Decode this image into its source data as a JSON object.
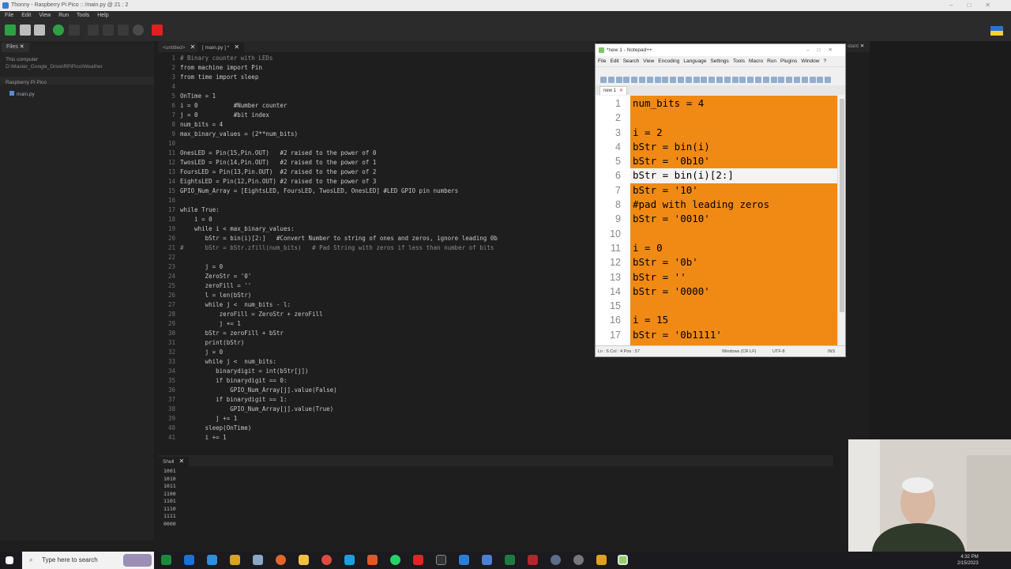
{
  "thonny": {
    "title": "Thonny - Raspberry Pi Pico :: /main.py @ 21 : 2",
    "menu": [
      "File",
      "Edit",
      "View",
      "Run",
      "Tools",
      "Help"
    ],
    "files_tab": "Files",
    "this_computer": "This computer",
    "computer_path": "D:\\Master_Google_Drive\\RPiPico\\Weather",
    "pico_label": "Raspberry Pi Pico",
    "pico_file": "main.py",
    "tabs": [
      "<untitled>",
      "[ main.py ] *"
    ],
    "shell_tab": "Shell",
    "right_tab_partial": "stant",
    "code_lines": [
      "# Binary counter with LEDs",
      "from machine import Pin",
      "from time import sleep",
      "",
      "OnTime = 1",
      "i = 0          #Number counter",
      "j = 0          #bit index",
      "num_bits = 4",
      "max_binary_values = (2**num_bits)",
      "",
      "OnesLED = Pin(15,Pin.OUT)   #2 raised to the power of 0",
      "TwosLED = Pin(14,Pin.OUT)   #2 raised to the power of 1",
      "FoursLED = Pin(13,Pin.OUT)  #2 raised to the power of 2",
      "EightsLED = Pin(12,Pin.OUT) #2 raised to the power of 3",
      "GPIO_Num_Array = [EightsLED, FoursLED, TwosLED, OnesLED] #LED GPIO pin numbers",
      "",
      "while True:",
      "    i = 0",
      "    while i < max_binary_values:",
      "       bStr = bin(i)[2:]   #Convert Number to string of ones and zeros, ignore leading 0b",
      "#      bStr = bStr.zfill(num_bits)   # Pad String with zeros if less than number of bits",
      "",
      "       j = 0",
      "       ZeroStr = '0'",
      "       zeroFill = ''",
      "       l = len(bStr)",
      "       while j <  num_bits - l:",
      "           zeroFill = ZeroStr + zeroFill",
      "           j += 1",
      "       bStr = zeroFill + bStr",
      "       print(bStr)",
      "       j = 0",
      "       while j <  num_bits:",
      "          binarydigit = int(bStr[j])",
      "          if binarydigit == 0:",
      "              GPIO_Num_Array[j].value(False)",
      "          if binarydigit == 1:",
      "              GPIO_Num_Array[j].value(True)",
      "          j += 1",
      "       sleep(OnTime)",
      "       i += 1"
    ],
    "shell_lines": [
      "1001",
      "1010",
      "1011",
      "1100",
      "1101",
      "1110",
      "1111",
      "0000"
    ]
  },
  "notepad": {
    "title": "*new 1 - Notepad++",
    "menu": [
      "File",
      "Edit",
      "Search",
      "View",
      "Encoding",
      "Language",
      "Settings",
      "Tools",
      "Macro",
      "Run",
      "Plugins",
      "Window",
      "?"
    ],
    "tab": "new 1",
    "lines": [
      "num_bits = 4",
      "",
      "i = 2",
      "bStr = bin(i)",
      "bStr = '0b10'",
      "bStr = bin(i)[2:]",
      "bStr = '10'",
      "#pad with leading zeros",
      "bStr = '0010'",
      "",
      "i = 0",
      "bStr = '0b'",
      "bStr = ''",
      "bStr = '0000'",
      "",
      "i = 15",
      "bStr = '0b1111'"
    ],
    "status": {
      "position": "Ln : 6    Col : 4    Pos : 57",
      "eol": "Windows (CR LF)",
      "encoding": "UTF-8",
      "mode": "INS"
    },
    "highlight_color": "#f08a14"
  },
  "taskbar": {
    "search_placeholder": "Type here to search",
    "time": "4:32 PM",
    "date": "2/15/2023"
  }
}
